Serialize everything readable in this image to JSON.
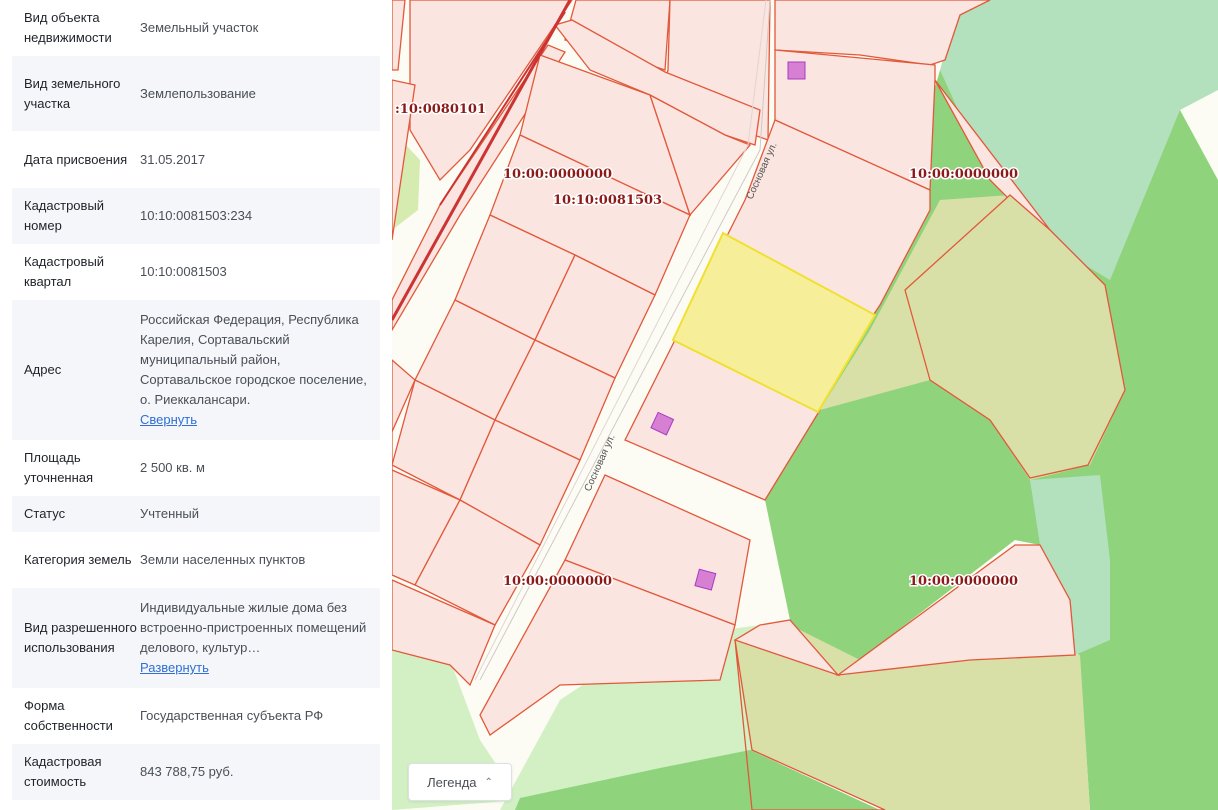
{
  "info_rows": [
    {
      "label": "Вид объекта недвижимости",
      "value": "Земельный участок"
    },
    {
      "label": "Вид земельного участка",
      "value": "Землепользование"
    },
    {
      "label": "Дата присвоения",
      "value": "31.05.2017"
    },
    {
      "label": "Кадастровый номер",
      "value": "10:10:0081503:234"
    },
    {
      "label": "Кадастровый квартал",
      "value": "10:10:0081503"
    },
    {
      "label": "Адрес",
      "value": "Российская Федерация, Республика Карелия, Сортавальский муниципальный район, Сортавальское городское поселение, о. Риеккалансари.",
      "link": "Свернуть"
    },
    {
      "label": "Площадь уточненная",
      "value": "2 500 кв. м"
    },
    {
      "label": "Статус",
      "value": "Учтенный"
    },
    {
      "label": "Категория земель",
      "value": "Земли населенных пунктов"
    },
    {
      "label": "Вид разрешенного использования",
      "value": "Индивидуальные жилые дома без встроенно-пристроенных помещений делового, культур…",
      "link": "Развернуть"
    },
    {
      "label": "Форма собственности",
      "value": "Государственная субъекта РФ"
    },
    {
      "label": "Кадастровая стоимость",
      "value": "843 788,75 руб."
    }
  ],
  "map": {
    "labels": {
      "l1": ":10:0080101",
      "l2": "10:00:0000000",
      "l3": "10:10:0081503",
      "l4": "10:00:0000000",
      "l5": "10:00:0000000",
      "l6": "10:00:0000000"
    },
    "street_a": "Сосновая ул.",
    "street_b": "Сосновая ул.",
    "colors": {
      "parcel_fill": "#fbe5e0",
      "parcel_stroke": "#e2583a",
      "selected_fill": "#f7ee9a",
      "selected_stroke": "#f0e030",
      "forest": "#8fd47c",
      "light_green": "#d2f0c4",
      "marker": "#d77fd3"
    }
  },
  "legend_button": {
    "label": "Легенда",
    "icon": "chevron-up-icon"
  }
}
